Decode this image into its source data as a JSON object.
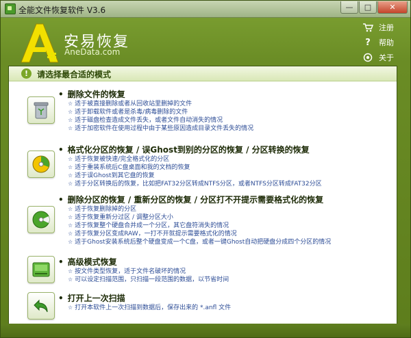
{
  "window": {
    "title": "全能文件恢复软件 V3.6"
  },
  "brand": {
    "name_cn": "安易恢复",
    "name_en": "AneData.com"
  },
  "toplinks": [
    {
      "label": "注册",
      "icon": "cart-icon"
    },
    {
      "label": "帮助",
      "icon": "question-icon"
    },
    {
      "label": "关于",
      "icon": "info-circle-icon"
    }
  ],
  "panel": {
    "title": "请选择最合适的模式"
  },
  "sections": [
    {
      "title": "删除文件的恢复",
      "icon": "recycle-bin-icon",
      "items": [
        "适于被直接删除或者从回收站里删掉的文件",
        "适于卸载软件或者是杀毒/病毒删除的文件",
        "适于磁盘检查造成文件丢失，或者文件自动消失的情况",
        "适于加密软件在使用过程中由于某些原因造成目录文件丢失的情况"
      ]
    },
    {
      "title": "格式化分区的恢复 / 误Ghost到别的分区的恢复 / 分区转换的恢复",
      "icon": "disk-format-icon",
      "items": [
        "适于恢复被快速/完全格式化的分区",
        "适于重装系统后C盘桌面和我的文档的恢复",
        "适于误Ghost到其它盘的恢复",
        "适于分区转换后的恢复，比如把FAT32分区转成NTFS分区，或者NTFS分区转成FAT32分区"
      ]
    },
    {
      "title": "删除分区的恢复 / 重新分区的恢复 / 分区打不开提示需要格式化的恢复",
      "icon": "partition-icon",
      "items": [
        "适于恢复删除掉的分区",
        "适于恢复重新分过区 / 调整分区大小",
        "适于恢复整个硬盘合并成一个分区，其它盘符消失的情况",
        "适于恢复分区变成RAW，一打不开就提示需要格式化的情况",
        "适于Ghost安装系统后整个硬盘变成一个C盘，或者一键Ghost自动把硬盘分成四个分区的情况"
      ]
    },
    {
      "title": "高级模式恢复",
      "icon": "drive-icon",
      "items": [
        "按文件类型恢复，适于文件名破坏的情况",
        "可以设定扫描范围，只扫描一段范围的数据，以节省时间"
      ]
    },
    {
      "title": "打开上一次扫描",
      "icon": "back-arrow-icon",
      "items": [
        "打开本软件上一次扫描到数据后，保存出来的 *.anfl 文件"
      ]
    }
  ]
}
